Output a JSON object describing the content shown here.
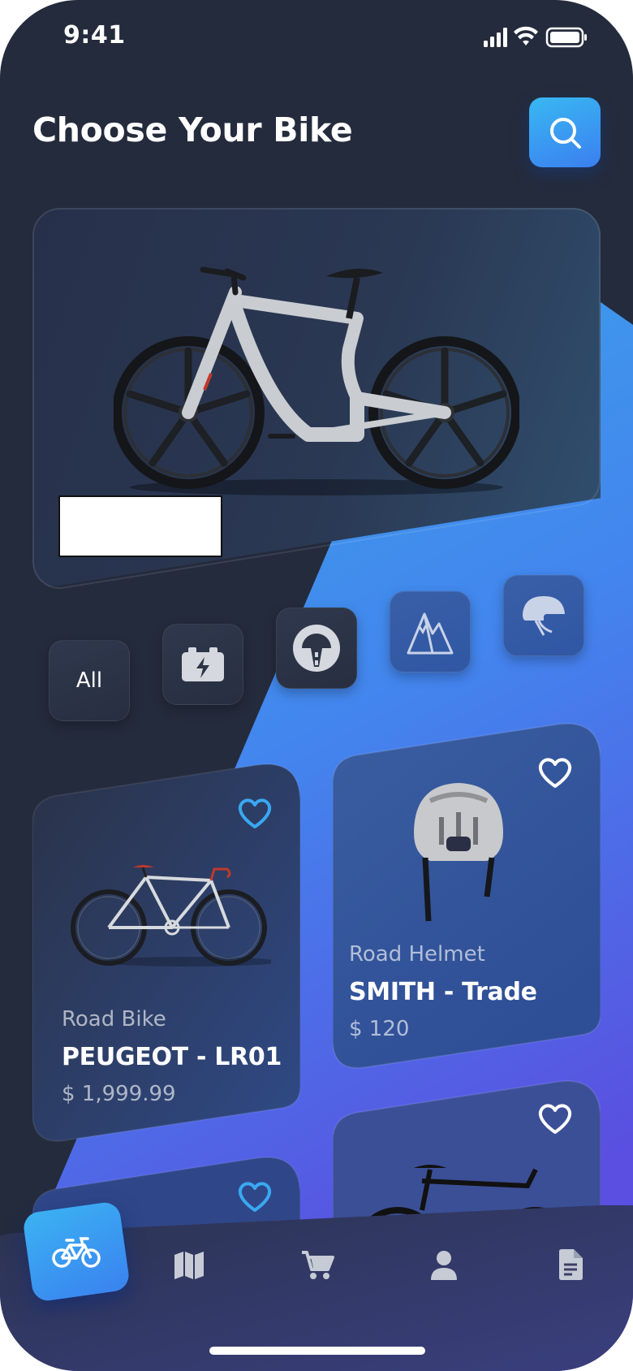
{
  "status_bar": {
    "time": "9:41"
  },
  "header": {
    "title": "Choose Your Bike"
  },
  "categories": [
    {
      "label": "All",
      "icon": "all-text"
    },
    {
      "icon": "battery-bolt-icon"
    },
    {
      "icon": "road-icon"
    },
    {
      "icon": "mountain-icon"
    },
    {
      "icon": "helmet-icon"
    }
  ],
  "products": [
    {
      "category": "Road Bike",
      "name": "PEUGEOT - LR01",
      "price": "$ 1,999.99",
      "favorite_color": "#3aa8f2"
    },
    {
      "category": "Road Helmet",
      "name": "SMITH - Trade",
      "price": "$ 120",
      "favorite_color": "#ffffff"
    }
  ],
  "nav": [
    "bike-icon",
    "map-icon",
    "cart-icon",
    "profile-icon",
    "document-icon"
  ],
  "colors": {
    "accent": "#3a8ff0",
    "background": "#242b3c"
  }
}
